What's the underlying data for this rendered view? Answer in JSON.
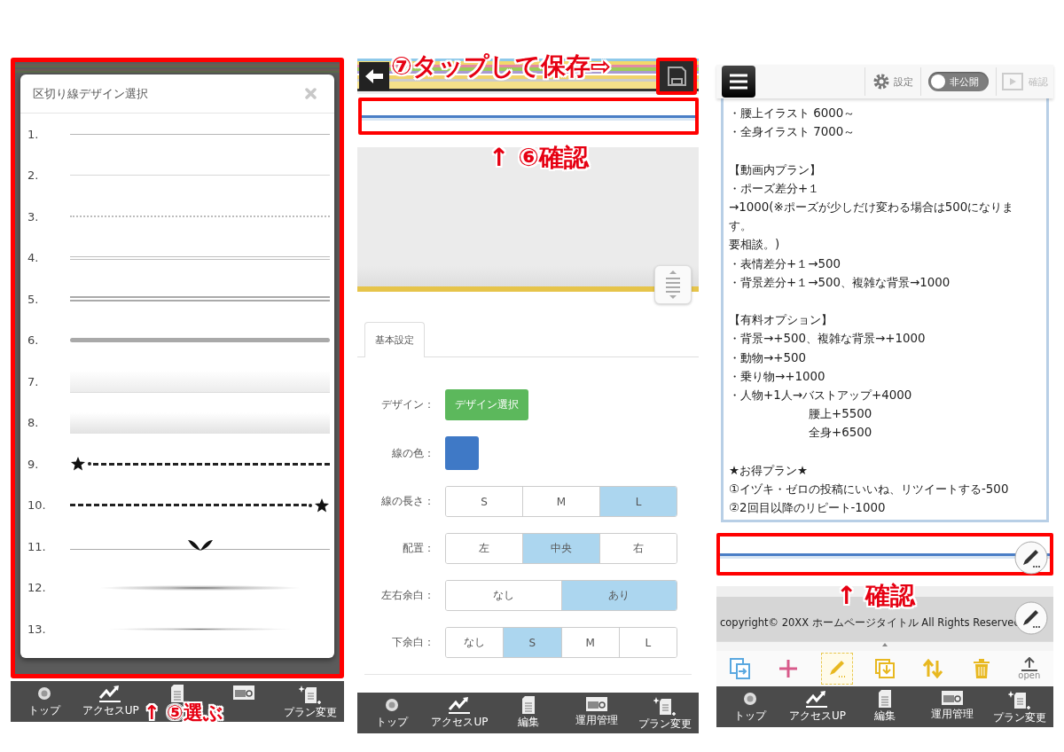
{
  "design_picker": {
    "title": "区切り線デザイン選択",
    "options": [
      {
        "label": "1.",
        "kind": "solid"
      },
      {
        "label": "2.",
        "kind": "hairline"
      },
      {
        "label": "3.",
        "kind": "dotted"
      },
      {
        "label": "4.",
        "kind": "double"
      },
      {
        "label": "5.",
        "kind": "doublebold"
      },
      {
        "label": "6.",
        "kind": "bold"
      },
      {
        "label": "7.",
        "kind": "fade"
      },
      {
        "label": "8.",
        "kind": "fadedown"
      },
      {
        "label": "9.",
        "kind": "starleft"
      },
      {
        "label": "10.",
        "kind": "starright"
      },
      {
        "label": "11.",
        "kind": "wings"
      },
      {
        "label": "12.",
        "kind": "shadow"
      },
      {
        "label": "13.",
        "kind": "shadowthin"
      }
    ],
    "annotation": "↑ ⑤選ぶ",
    "nav": [
      {
        "kind": "top",
        "label": "トップ"
      },
      {
        "kind": "access",
        "label": "アクセスUP"
      },
      {
        "kind": "edit"
      },
      {
        "kind": "manage"
      },
      {
        "kind": "plan",
        "label": "プラン変更"
      }
    ]
  },
  "line_settings": {
    "save_annotation": "⑦タップして保存⇨",
    "check_annotation": "↑ ⑥確認",
    "tabs": [
      {
        "label": "基本設定",
        "selected": true
      }
    ],
    "rows": [
      {
        "kind": "button",
        "label": "デザイン：",
        "button": "デザイン選択"
      },
      {
        "kind": "swatch",
        "label": "線の色：",
        "color": "#3f79c6"
      },
      {
        "kind": "segments",
        "label": "線の長さ：",
        "options": [
          {
            "label": "S",
            "selected": false
          },
          {
            "label": "M",
            "selected": false
          },
          {
            "label": "L",
            "selected": true
          }
        ]
      },
      {
        "kind": "segments",
        "label": "配置：",
        "options": [
          {
            "label": "左",
            "selected": false
          },
          {
            "label": "中央",
            "selected": true
          },
          {
            "label": "右",
            "selected": false
          }
        ]
      },
      {
        "kind": "segments",
        "label": "左右余白：",
        "options": [
          {
            "label": "なし",
            "selected": false
          },
          {
            "label": "あり",
            "selected": true
          }
        ]
      },
      {
        "kind": "segments",
        "label": "下余白：",
        "options": [
          {
            "label": "なし",
            "selected": false
          },
          {
            "label": "S",
            "selected": true
          },
          {
            "label": "M",
            "selected": false
          },
          {
            "label": "L",
            "selected": false
          }
        ]
      }
    ],
    "nav": [
      {
        "kind": "top",
        "label": "トップ"
      },
      {
        "kind": "access",
        "label": "アクセスUP"
      },
      {
        "kind": "edit",
        "label": "編集"
      },
      {
        "kind": "manage",
        "label": "運用管理"
      },
      {
        "kind": "plan",
        "label": "プラン変更"
      }
    ]
  },
  "page_editor": {
    "toolbar": {
      "settings": "設定",
      "toggle": {
        "label": "非公開",
        "on": false
      },
      "preview": "確認"
    },
    "text_lines": [
      {
        "kind": "line",
        "text": "・腰上イラスト 6000～"
      },
      {
        "kind": "line",
        "text": "・全身イラスト 7000～"
      },
      {
        "kind": "gap"
      },
      {
        "kind": "line",
        "text": "【動画内プラン】"
      },
      {
        "kind": "line",
        "text": "・ポーズ差分+１"
      },
      {
        "kind": "line",
        "text": "→1000(※ポーズが少しだけ変わる場合は500になりま"
      },
      {
        "kind": "line",
        "text": "す。"
      },
      {
        "kind": "line",
        "text": "要相談。)"
      },
      {
        "kind": "line",
        "text": "・表情差分+１→500"
      },
      {
        "kind": "line",
        "text": "・背景差分+１→500、複雑な背景→1000"
      },
      {
        "kind": "gap"
      },
      {
        "kind": "line",
        "text": "【有料オプション】"
      },
      {
        "kind": "line",
        "text": "・背景→+500、複雑な背景→+1000"
      },
      {
        "kind": "line",
        "text": "・動物→+500"
      },
      {
        "kind": "line",
        "text": "・乗り物→+1000"
      },
      {
        "kind": "line",
        "text": "・人物+1人→バストアップ+4000"
      },
      {
        "kind": "indent",
        "text": "腰上+5500"
      },
      {
        "kind": "indent",
        "text": "全身+6500"
      },
      {
        "kind": "gap"
      },
      {
        "kind": "line",
        "text": "★お得プラン★"
      },
      {
        "kind": "line",
        "text": "①イヅキ・ゼロの投稿にいいね、リツイートする-500"
      },
      {
        "kind": "line",
        "text": "②2回目以降のリピート-1000"
      }
    ],
    "check_annotation": "↑ 確認",
    "copyright": "copyright© 20XX ホームページタイトル All Rights Reservec",
    "tools": [
      {
        "kind": "copy",
        "selected": false
      },
      {
        "kind": "add",
        "selected": false
      },
      {
        "kind": "edit",
        "selected": true
      },
      {
        "kind": "import",
        "selected": false
      },
      {
        "kind": "sort",
        "selected": false
      },
      {
        "kind": "delete",
        "selected": false
      },
      {
        "kind": "open",
        "label": "open",
        "selected": false
      }
    ],
    "nav": [
      {
        "kind": "top",
        "label": "トップ"
      },
      {
        "kind": "access",
        "label": "アクセスUP"
      },
      {
        "kind": "edit",
        "label": "編集"
      },
      {
        "kind": "manage",
        "label": "運用管理"
      },
      {
        "kind": "plan",
        "label": "プラン変更"
      }
    ]
  }
}
